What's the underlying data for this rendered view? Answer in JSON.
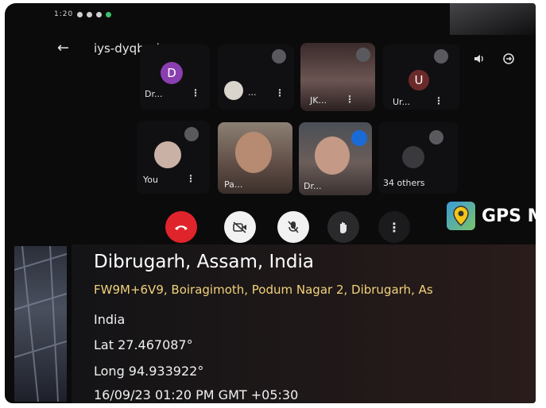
{
  "status_bar": {
    "time": "1:20"
  },
  "header": {
    "meeting_code": "iys-dyqb-gkn",
    "back_icon": "back-arrow-icon"
  },
  "participants_row1": [
    {
      "name": "Dr...",
      "initial": "D",
      "color": "#8a3fb0"
    },
    {
      "name": "..."
    },
    {
      "name": "JK..."
    },
    {
      "name": "Ur...",
      "initial": "U",
      "color": "#6b2a2a"
    }
  ],
  "participants_row2": [
    {
      "name": "You"
    },
    {
      "name": "Pa..."
    },
    {
      "name": "Dr..."
    },
    {
      "name": "34 others"
    }
  ],
  "controls": {
    "end_call": "end-call",
    "camera": "camera-off",
    "mic": "mic-off",
    "raise_hand": "raise-hand",
    "more": "more"
  },
  "gps_overlay": {
    "app_name": "GPS M",
    "location_title": "Dibrugarh, Assam, India",
    "address": "FW9M+6V9, Boiragimoth, Podum Nagar 2, Dibrugarh, As",
    "country": "India",
    "lat": "Lat 27.467087°",
    "long": "Long 94.933922°",
    "datetime": "16/09/23 01:20 PM GMT +05:30"
  }
}
